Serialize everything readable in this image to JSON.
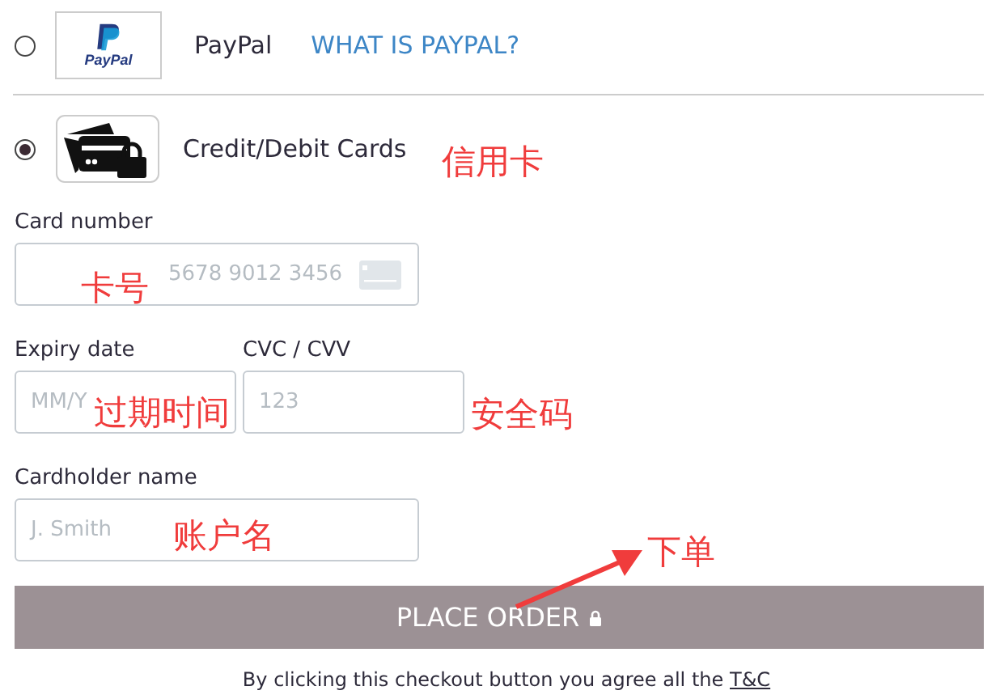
{
  "payment_methods": [
    {
      "kind": "paypal",
      "logo_text": "PayPal",
      "label": "PayPal",
      "link": "WHAT IS PAYPAL?",
      "selected": false
    },
    {
      "kind": "card",
      "label": "Credit/Debit Cards",
      "selected": true
    }
  ],
  "card_form": {
    "card_number": {
      "label": "Card number",
      "placeholder": "5678 9012 3456"
    },
    "expiry": {
      "label": "Expiry date",
      "placeholder": "MM/Y"
    },
    "cvc": {
      "label": "CVC / CVV",
      "placeholder": "123"
    },
    "cardholder": {
      "label": "Cardholder name",
      "placeholder": "J. Smith"
    }
  },
  "place_order_button": {
    "label": "PLACE ORDER"
  },
  "terms": {
    "text": "By clicking this checkout button you agree all the",
    "link": "T&C"
  },
  "annotations": [
    {
      "text": "信用卡",
      "arrow": false
    },
    {
      "text": "卡号",
      "arrow": false
    },
    {
      "text": "过期时间",
      "arrow": false
    },
    {
      "text": "安全码",
      "arrow": false
    },
    {
      "text": "账户名",
      "arrow": false
    },
    {
      "text": "下单",
      "arrow": true
    }
  ]
}
